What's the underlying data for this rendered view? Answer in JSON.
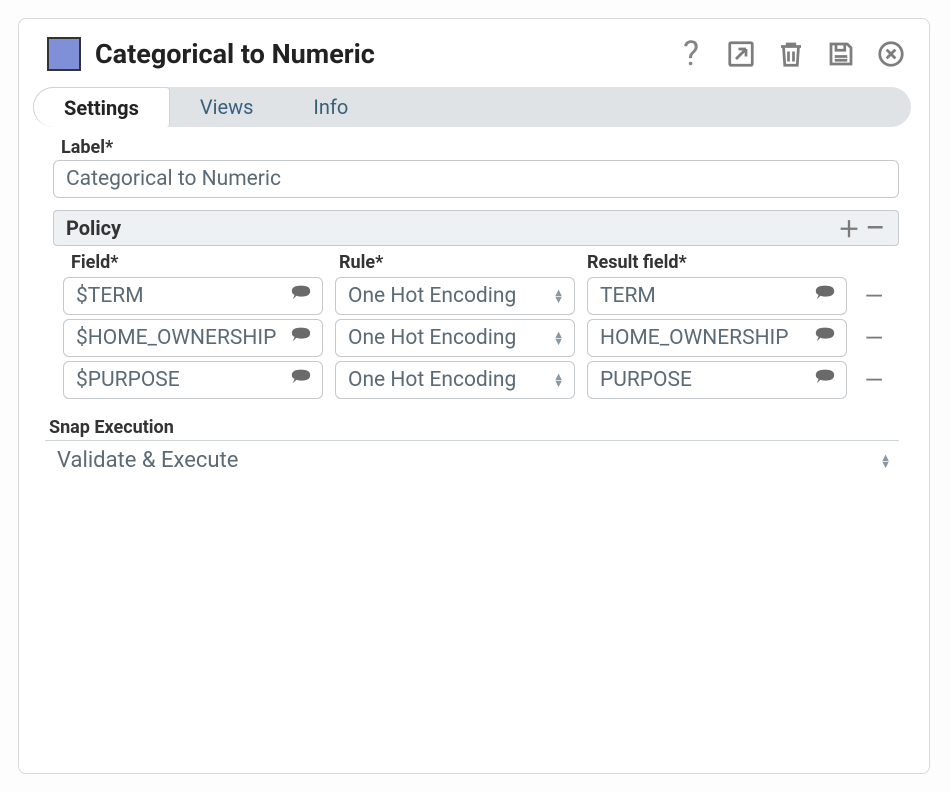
{
  "header": {
    "title": "Categorical to Numeric",
    "swatch_color": "#8090d8"
  },
  "tabs": [
    {
      "label": "Settings",
      "active": true
    },
    {
      "label": "Views",
      "active": false
    },
    {
      "label": "Info",
      "active": false
    }
  ],
  "label_field": {
    "label": "Label*",
    "value": "Categorical to Numeric"
  },
  "policy_section": {
    "title": "Policy",
    "columns": {
      "field": "Field*",
      "rule": "Rule*",
      "result": "Result field*"
    },
    "rows": [
      {
        "field": "$TERM",
        "rule": "One Hot Encoding",
        "result": "TERM"
      },
      {
        "field": "$HOME_OWNERSHIP",
        "rule": "One Hot Encoding",
        "result": "HOME_OWNERSHIP"
      },
      {
        "field": "$PURPOSE",
        "rule": "One Hot Encoding",
        "result": "PURPOSE"
      }
    ]
  },
  "snap_execution": {
    "label": "Snap Execution",
    "value": "Validate & Execute"
  }
}
